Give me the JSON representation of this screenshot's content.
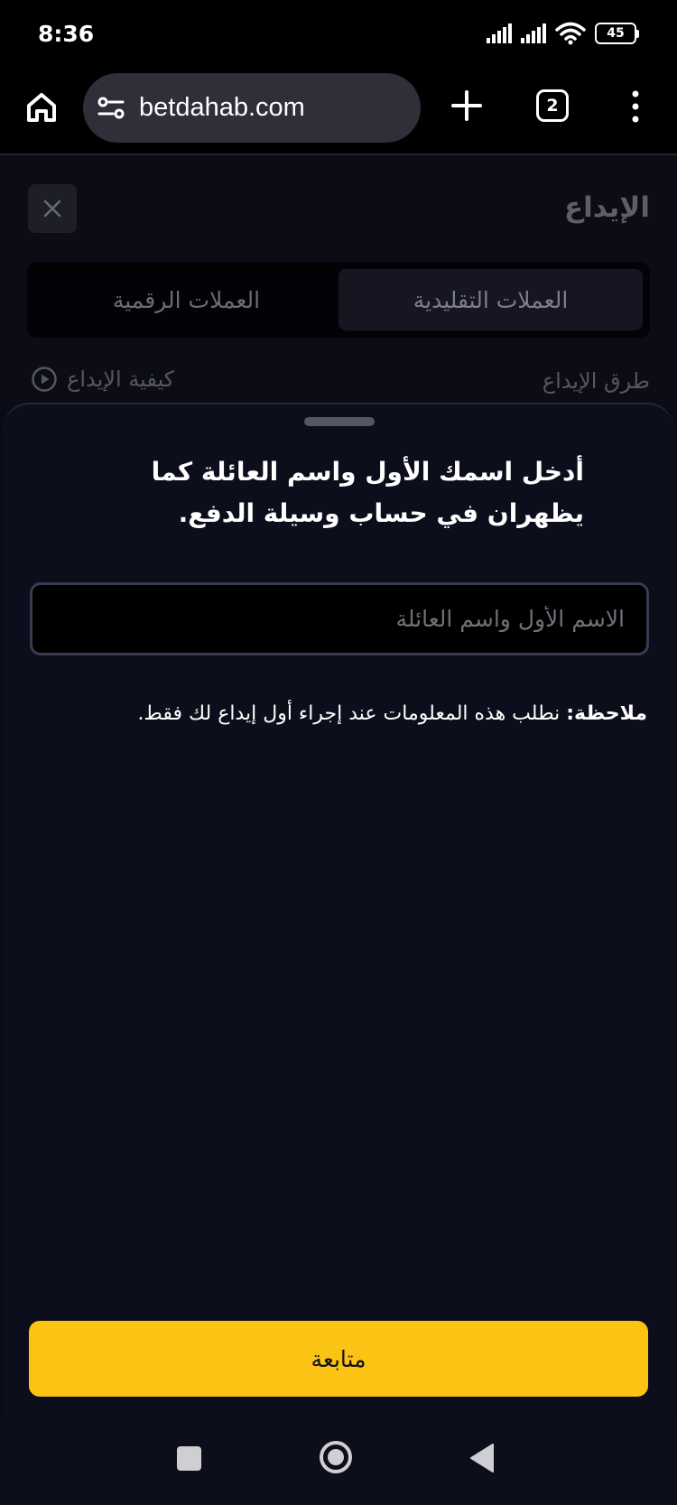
{
  "status_bar": {
    "time": "8:36",
    "battery": "45",
    "icons": [
      "signal-icon",
      "signal-icon",
      "wifi-icon",
      "battery-icon"
    ]
  },
  "browser": {
    "url": "betdahab.com",
    "tab_count": "2",
    "icons": [
      "home-icon",
      "site-settings-icon",
      "plus-icon",
      "tabs-icon",
      "more-vert-icon"
    ]
  },
  "page": {
    "title": "الإيداع",
    "tabs": [
      {
        "label": "العملات التقليدية",
        "active": true
      },
      {
        "label": "العملات الرقمية",
        "active": false
      }
    ],
    "methods_label": "طرق الإيداع",
    "howto_label": "كيفية الإيداع"
  },
  "sheet": {
    "heading": "أدخل اسمك الأول واسم العائلة كما يظهران في حساب وسيلة الدفع.",
    "input": {
      "value": "",
      "placeholder": "الاسم الأول واسم العائلة"
    },
    "note_label": "ملاحظة:",
    "note_text": " نطلب هذه المعلومات عند إجراء أول إيداع لك فقط."
  },
  "continue_label": "متابعة",
  "colors": {
    "accent": "#fbc314",
    "background": "#0a0b16",
    "sheet": "#0d0e1b"
  }
}
